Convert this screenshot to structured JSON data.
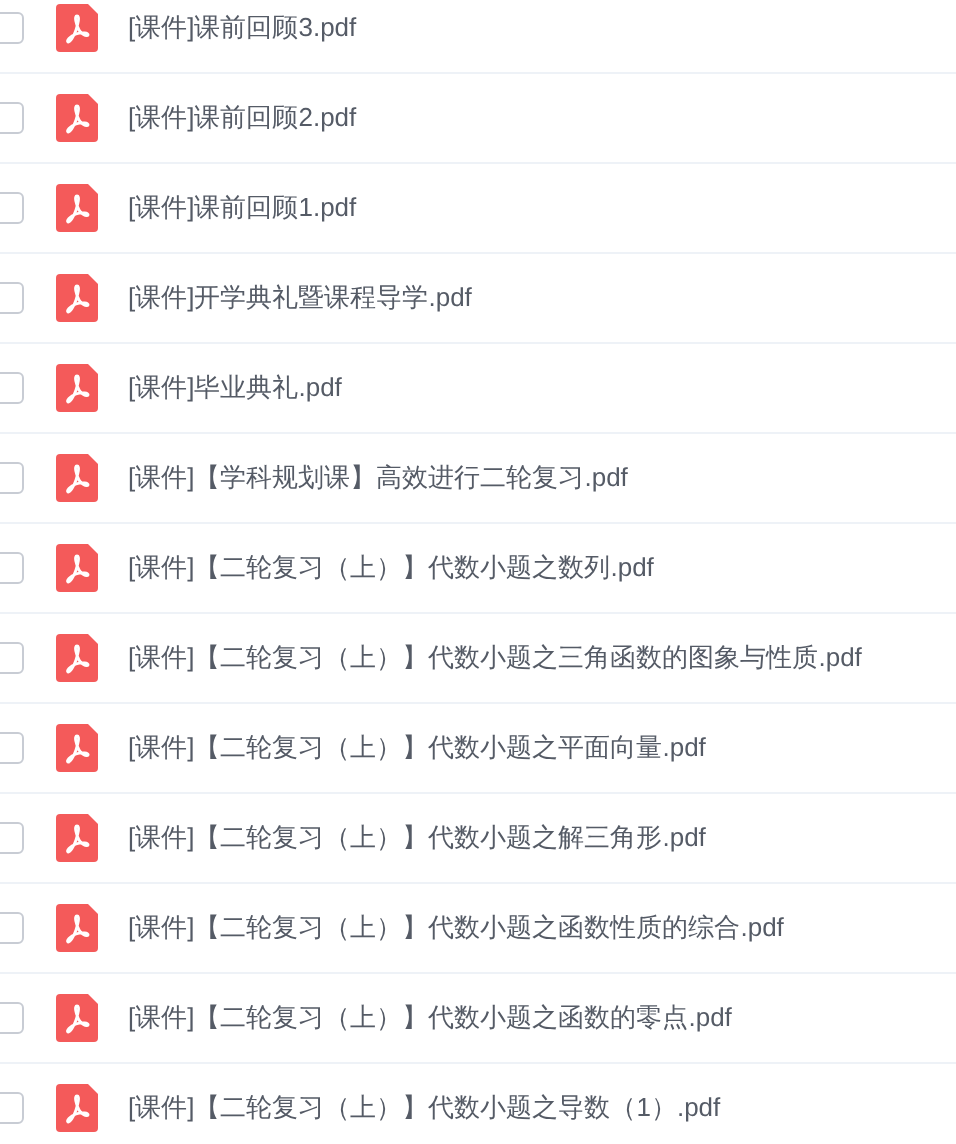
{
  "files": [
    {
      "name": "[课件]课前回顾3.pdf",
      "checked": false
    },
    {
      "name": "[课件]课前回顾2.pdf",
      "checked": false
    },
    {
      "name": "[课件]课前回顾1.pdf",
      "checked": false
    },
    {
      "name": "[课件]开学典礼暨课程导学.pdf",
      "checked": false
    },
    {
      "name": "[课件]毕业典礼.pdf",
      "checked": false
    },
    {
      "name": "[课件]【学科规划课】高效进行二轮复习.pdf",
      "checked": false
    },
    {
      "name": "[课件]【二轮复习（上）】代数小题之数列.pdf",
      "checked": false
    },
    {
      "name": "[课件]【二轮复习（上）】代数小题之三角函数的图象与性质.pdf",
      "checked": false
    },
    {
      "name": "[课件]【二轮复习（上）】代数小题之平面向量.pdf",
      "checked": false
    },
    {
      "name": "[课件]【二轮复习（上）】代数小题之解三角形.pdf",
      "checked": false
    },
    {
      "name": "[课件]【二轮复习（上）】代数小题之函数性质的综合.pdf",
      "checked": false
    },
    {
      "name": "[课件]【二轮复习（上）】代数小题之函数的零点.pdf",
      "checked": false
    },
    {
      "name": "[课件]【二轮复习（上）】代数小题之导数（1）.pdf",
      "checked": false
    }
  ]
}
